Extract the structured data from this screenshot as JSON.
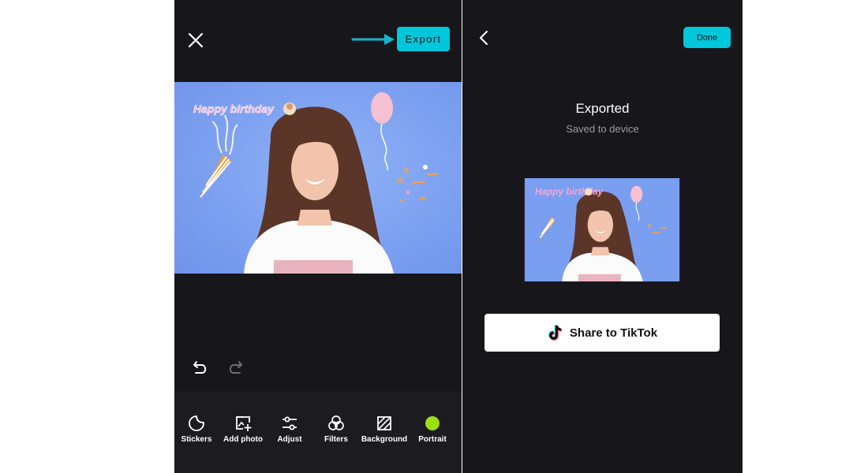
{
  "editor": {
    "export_label": "Export",
    "canvas_text": "Happy birthday",
    "toolbar": [
      {
        "label": "Stickers",
        "icon": "sticker-icon"
      },
      {
        "label": "Add photo",
        "icon": "add-photo-icon"
      },
      {
        "label": "Adjust",
        "icon": "adjust-sliders-icon"
      },
      {
        "label": "Filters",
        "icon": "filters-icon"
      },
      {
        "label": "Background",
        "icon": "background-icon"
      },
      {
        "label": "Portrait",
        "icon": "portrait-dot-icon"
      }
    ]
  },
  "export_screen": {
    "done_label": "Done",
    "title": "Exported",
    "subtitle": "Saved to device",
    "thumb_text": "Happy birthday",
    "share_label": "Share to TikTok"
  },
  "colors": {
    "accent": "#00c7dc",
    "panel_bg": "#17161b",
    "canvas_bg": "#7ea2f0",
    "portrait_dot": "#9be012"
  }
}
